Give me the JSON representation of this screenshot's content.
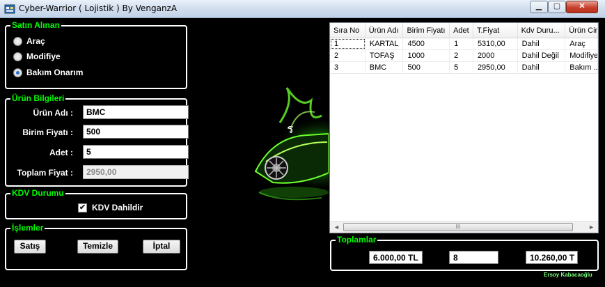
{
  "window": {
    "title": "Cyber-Warrior ( Lojistik ) By VenganzA",
    "min_glyph": "▁",
    "max_glyph": "▢",
    "close_glyph": "✕"
  },
  "satin_alinan": {
    "legend": "Satın Alınan",
    "options": [
      {
        "label": "Araç",
        "checked": false
      },
      {
        "label": "Modifiye",
        "checked": false
      },
      {
        "label": "Bakım Onarım",
        "checked": true
      }
    ]
  },
  "urun_bilgileri": {
    "legend": "Ürün Bilgileri",
    "urun_adi_label": "Ürün Adı :",
    "urun_adi_value": "BMC",
    "birim_fiyati_label": "Birim Fiyatı :",
    "birim_fiyati_value": "500",
    "adet_label": "Adet :",
    "adet_value": "5",
    "toplam_fiyat_label": "Toplam Fiyat :",
    "toplam_fiyat_value": "2950,00"
  },
  "kdv": {
    "legend": "KDV Durumu",
    "checkbox_label": "KDV Dahildir",
    "checked": true,
    "check_glyph": "✔"
  },
  "islemler": {
    "legend": "İşlemler",
    "satis": "Satış",
    "temizle": "Temizle",
    "iptal": "İptal"
  },
  "grid": {
    "columns": [
      "Sıra No",
      "Ürün Adı",
      "Birim Fiyatı",
      "Adet",
      "T.Fiyat",
      "Kdv Duru...",
      "Ürün Cins"
    ],
    "rows": [
      [
        "1",
        "KARTAL",
        "4500",
        "1",
        "5310,00",
        "Dahil",
        "Araç"
      ],
      [
        "2",
        "TOFAŞ",
        "1000",
        "2",
        "2000",
        "Dahil Değil",
        "Modifiye"
      ],
      [
        "3",
        "BMC",
        "500",
        "5",
        "2950,00",
        "Dahil",
        "Bakım ..."
      ]
    ],
    "scroll_left": "◄",
    "scroll_right": "►",
    "scroll_grip": "III"
  },
  "toplamlar": {
    "legend": "Toplamlar",
    "total_1": "6.000,00 TL",
    "total_2": "8",
    "total_3": "10.260,00 T"
  },
  "credit": "Ersoy Kabacaoğlu",
  "colors": {
    "legend_green": "#00ff00",
    "background": "#000000",
    "border": "#ffffff"
  }
}
